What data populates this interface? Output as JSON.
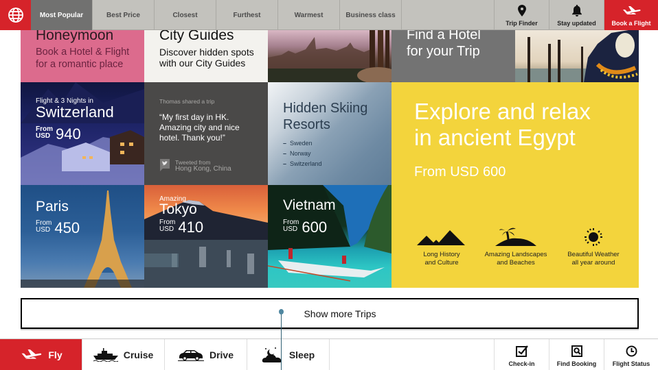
{
  "topbar": {
    "logo_icon": "globe-icon",
    "tabs": [
      {
        "label": "Most Popular",
        "active": true
      },
      {
        "label": "Best Price",
        "active": false
      },
      {
        "label": "Closest",
        "active": false
      },
      {
        "label": "Furthest",
        "active": false
      },
      {
        "label": "Warmest",
        "active": false
      },
      {
        "label": "Business class",
        "active": false
      }
    ],
    "actions": [
      {
        "label": "Trip Finder",
        "icon": "map-pin-icon"
      },
      {
        "label": "Stay updated",
        "icon": "bell-icon"
      },
      {
        "label": "Book a Flight",
        "icon": "plane-icon"
      }
    ]
  },
  "tiles": {
    "honeymoon": {
      "title": "Honeymoon",
      "subtitle_1": "Book a Hotel & Flight",
      "subtitle_2": "for a romantic place"
    },
    "city_guides": {
      "title": "City Guides",
      "subtitle_1": "Discover hidden spots",
      "subtitle_2": "with our City Guides"
    },
    "find_hotel": {
      "line_1": "Find a Hotel",
      "line_2": "for your Trip"
    },
    "switzerland": {
      "kicker": "Flight & 3 Nights in",
      "title": "Switzerland",
      "from": "From",
      "currency": "USD",
      "price": "940"
    },
    "tweet": {
      "author": "Thomas shared a trip",
      "quote_1": "“My first day in HK.",
      "quote_2": "Amazing city and nice",
      "quote_3": "hotel. Thank you!”",
      "via": "Tweeted from",
      "location": "Hong Kong, China"
    },
    "skiing": {
      "title_1": "Hidden Skiing",
      "title_2": "Resorts",
      "items": [
        "Sweden",
        "Norway",
        "Switzerland"
      ]
    },
    "egypt": {
      "title_1": "Explore and relax",
      "title_2": "in ancient Egypt",
      "price": "From USD 600",
      "features": [
        {
          "line_1": "Long History",
          "line_2": "and Culture",
          "icon": "pyramids-icon"
        },
        {
          "line_1": "Amazing Landscapes",
          "line_2": "and Beaches",
          "icon": "palm-island-icon"
        },
        {
          "line_1": "Beautiful Weather",
          "line_2": "all year around",
          "icon": "sun-icon"
        }
      ]
    },
    "paris": {
      "title": "Paris",
      "from": "From",
      "currency": "USD",
      "price": "450"
    },
    "tokyo": {
      "kicker": "Amazing",
      "title": "Tokyo",
      "from": "From",
      "currency": "USD",
      "price": "410"
    },
    "vietnam": {
      "title": "Vietnam",
      "from": "From",
      "currency": "USD",
      "price": "600"
    }
  },
  "show_more": {
    "label": "Show more Trips"
  },
  "bottombar": {
    "modes": [
      {
        "label": "Fly",
        "icon": "plane-icon",
        "active": true
      },
      {
        "label": "Cruise",
        "icon": "ship-icon",
        "active": false
      },
      {
        "label": "Drive",
        "icon": "car-icon",
        "active": false
      },
      {
        "label": "Sleep",
        "icon": "moon-cloud-icon",
        "active": false
      }
    ],
    "actions": [
      {
        "label": "Check-in",
        "icon": "checkbox-icon"
      },
      {
        "label": "Find Booking",
        "icon": "search-doc-icon"
      },
      {
        "label": "Flight Status",
        "icon": "clock-icon"
      }
    ]
  },
  "colors": {
    "brand_red": "#d6232a",
    "egypt_yellow": "#f3d43c",
    "honeymoon_pink": "#dc6b8d",
    "tab_bar": "#c3c2bd"
  }
}
